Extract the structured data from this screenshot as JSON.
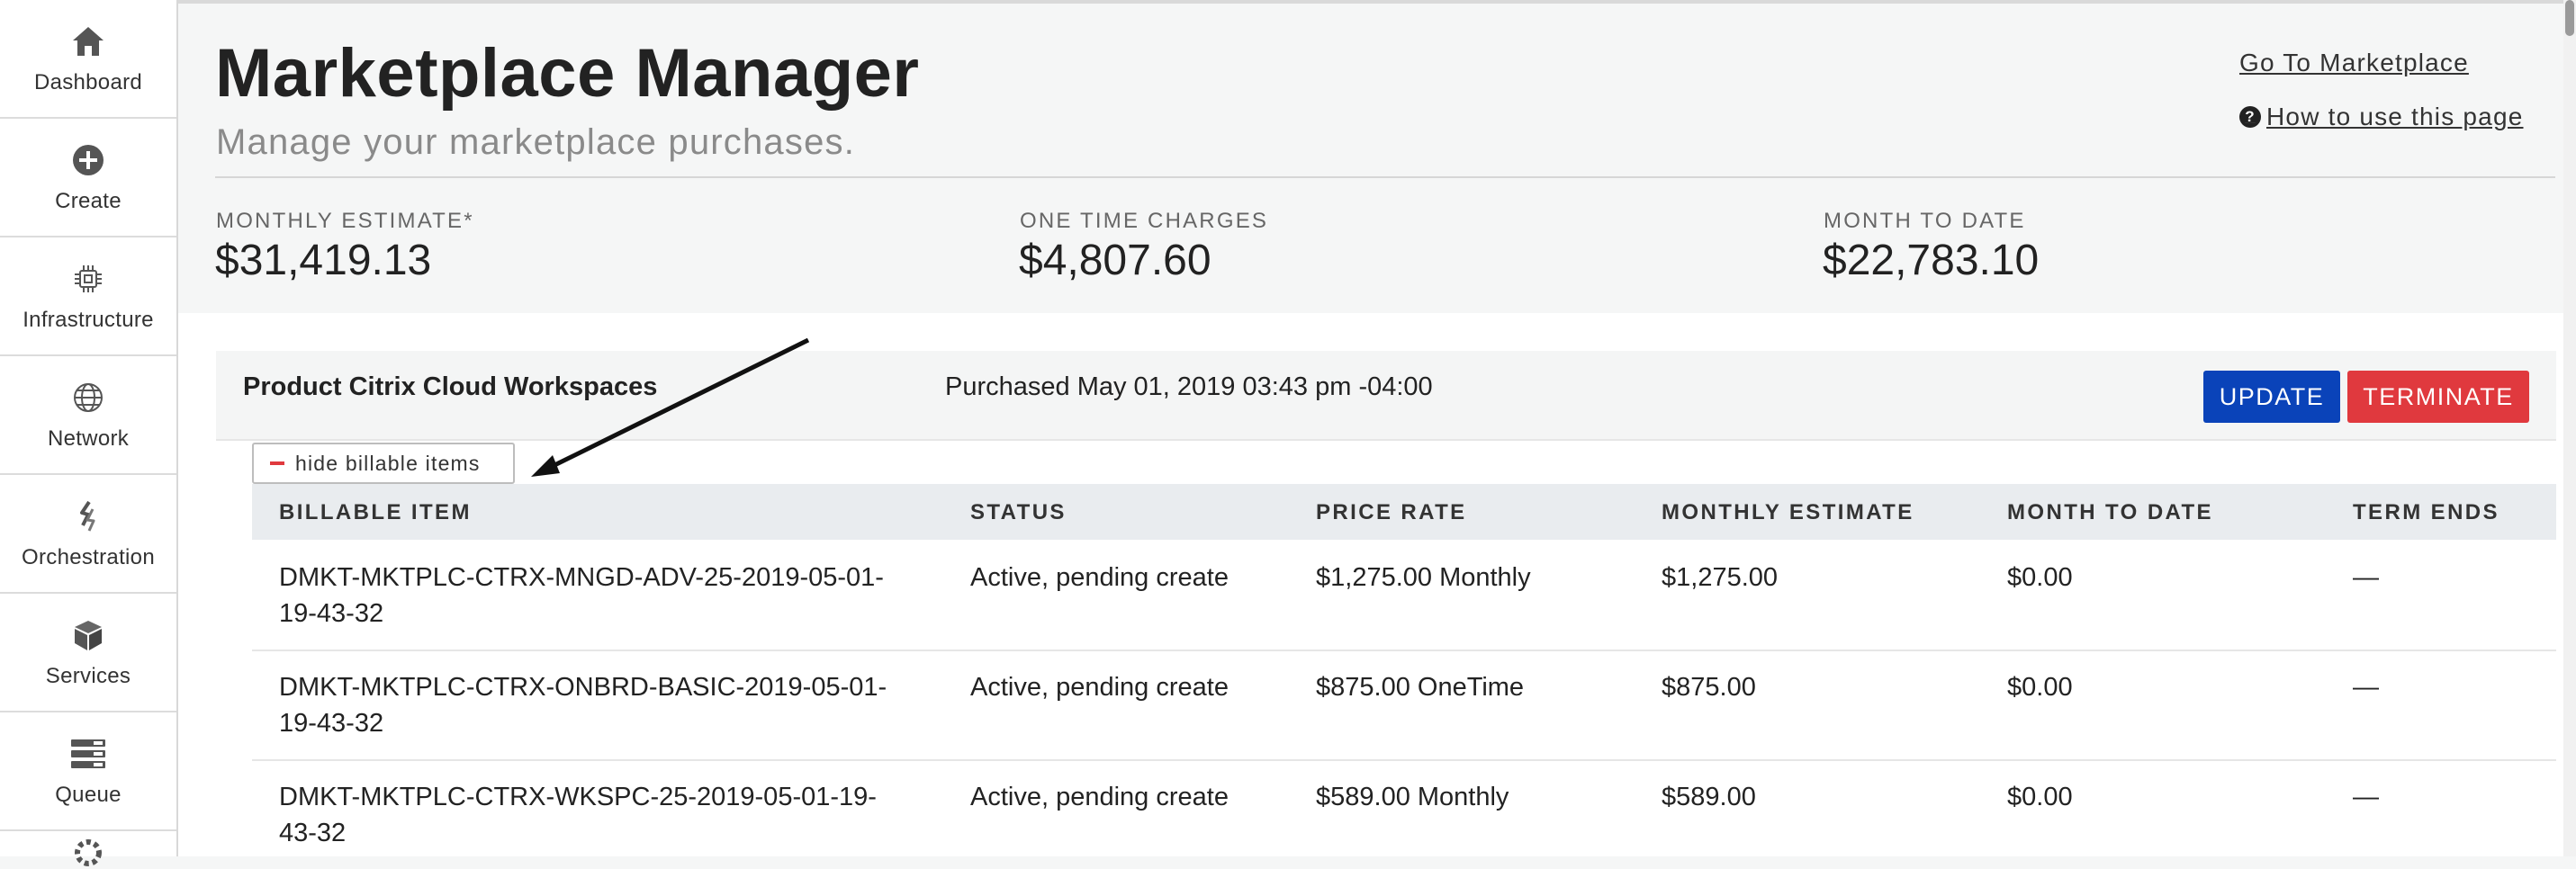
{
  "sidebar": {
    "items": [
      {
        "label": "Dashboard",
        "icon": "home-icon"
      },
      {
        "label": "Create",
        "icon": "plus-circle-icon"
      },
      {
        "label": "Infrastructure",
        "icon": "chip-icon"
      },
      {
        "label": "Network",
        "icon": "globe-icon"
      },
      {
        "label": "Orchestration",
        "icon": "orchestration-icon"
      },
      {
        "label": "Services",
        "icon": "cube-icon"
      },
      {
        "label": "Queue",
        "icon": "queue-icon"
      }
    ]
  },
  "header": {
    "title": "Marketplace Manager",
    "subtitle": "Manage your marketplace purchases.",
    "go_to_marketplace": "Go To Marketplace",
    "how_to_use": " How to use this page"
  },
  "stats": [
    {
      "label": "MONTHLY ESTIMATE*",
      "value": "$31,419.13"
    },
    {
      "label": "ONE TIME CHARGES",
      "value": "$4,807.60"
    },
    {
      "label": "MONTH TO DATE",
      "value": "$22,783.10"
    }
  ],
  "product": {
    "name": "Product Citrix Cloud Workspaces",
    "purchased": "Purchased May 01, 2019 03:43 pm -04:00",
    "update_label": "UPDATE",
    "terminate_label": "TERMINATE",
    "toggle_label": "hide billable items"
  },
  "table": {
    "columns": [
      "BILLABLE ITEM",
      "STATUS",
      "PRICE RATE",
      "MONTHLY ESTIMATE",
      "MONTH TO DATE",
      "TERM ENDS"
    ],
    "rows": [
      {
        "item_line1": "DMKT-MKTPLC-CTRX-MNGD-ADV-25-2019-05-01-",
        "item_line2": "19-43-32",
        "status": "Active, pending create",
        "rate": "$1,275.00 Monthly",
        "monthly": "$1,275.00",
        "mtd": "$0.00",
        "term": "—"
      },
      {
        "item_line1": "DMKT-MKTPLC-CTRX-ONBRD-BASIC-2019-05-01-",
        "item_line2": "19-43-32",
        "status": "Active, pending create",
        "rate": "$875.00 OneTime",
        "monthly": "$875.00",
        "mtd": "$0.00",
        "term": "—"
      },
      {
        "item_line1": "DMKT-MKTPLC-CTRX-WKSPC-25-2019-05-01-19-",
        "item_line2": "43-32",
        "status": "Active, pending create",
        "rate": "$589.00 Monthly",
        "monthly": "$589.00",
        "mtd": "$0.00",
        "term": "—"
      }
    ]
  },
  "colors": {
    "update": "#0a43b9",
    "terminate": "#e0393e",
    "table_header_bg": "#e9ecef"
  }
}
